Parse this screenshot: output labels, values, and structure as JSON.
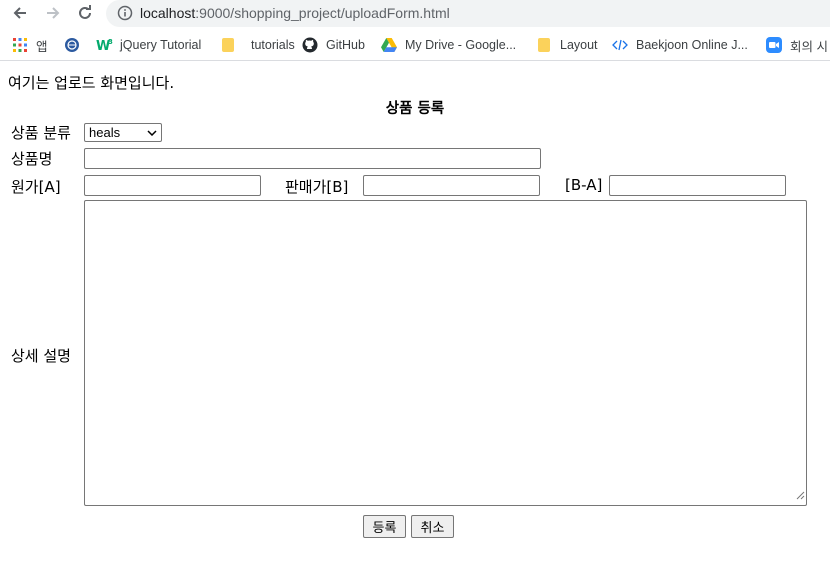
{
  "browser": {
    "url_host": "localhost",
    "url_path": ":9000/shopping_project/uploadForm.html",
    "bookmarks": [
      {
        "label": "앱",
        "icon": "apps-grid-icon"
      },
      {
        "label": "",
        "icon": "site-emblem-icon"
      },
      {
        "label": "jQuery Tutorial",
        "icon": "w3schools-icon"
      },
      {
        "label": "tutorials",
        "icon": "folder-icon"
      },
      {
        "label": "GitHub",
        "icon": "github-icon"
      },
      {
        "label": "My Drive - Google...",
        "icon": "google-drive-icon"
      },
      {
        "label": "Layout",
        "icon": "folder-icon"
      },
      {
        "label": "Baekjoon Online J...",
        "icon": "code-icon"
      },
      {
        "label": "회의 시",
        "icon": "zoom-icon"
      }
    ]
  },
  "page": {
    "intro": "여기는 업로드 화면입니다.",
    "title": "상품 등록",
    "category_label": "상품 분류",
    "category_value": "heals",
    "name_label": "상품명",
    "cost_label": "원가[A]",
    "price_label": "판매가[B]",
    "margin_label": "[B-A]",
    "detail_label": "상세 설명",
    "submit_label": "등록",
    "cancel_label": "취소"
  },
  "colors": {
    "omnibox_bg": "#f1f3f4",
    "button_bg": "#efefef",
    "input_border": "#767676"
  }
}
